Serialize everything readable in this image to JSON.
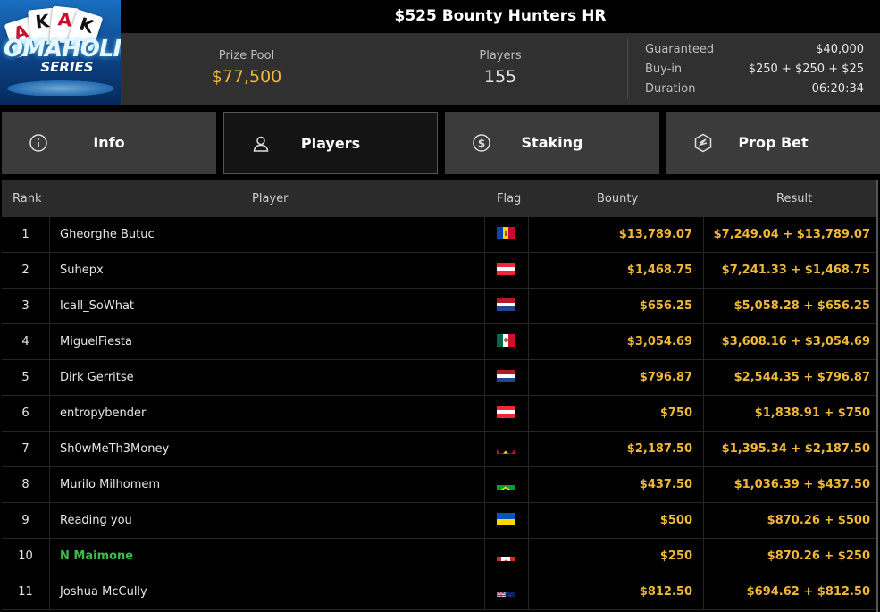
{
  "title": "$525 Bounty Hunters HR",
  "logo": {
    "cards": [
      "A",
      "K",
      "A",
      "K"
    ],
    "word1": "OMAHOLIC",
    "word2": "SERIES"
  },
  "stats": {
    "prize_pool": {
      "label": "Prize Pool",
      "value": "$77,500",
      "color": "#f0b83a"
    },
    "players": {
      "label": "Players",
      "value": "155"
    }
  },
  "details": [
    {
      "label": "Guaranteed",
      "value": "$40,000"
    },
    {
      "label": "Buy-in",
      "value": "$250 + $250 + $25"
    },
    {
      "label": "Duration",
      "value": "06:20:34"
    }
  ],
  "tabs": [
    {
      "label": "Info",
      "icon": "info-icon"
    },
    {
      "label": "Players",
      "icon": "user-icon",
      "active": true
    },
    {
      "label": "Staking",
      "icon": "staking-coin-icon"
    },
    {
      "label": "Prop Bet",
      "icon": "prop-bet-icon"
    }
  ],
  "table": {
    "headers": {
      "rank": "Rank",
      "player": "Player",
      "flag": "Flag",
      "bounty": "Bounty",
      "result": "Result"
    },
    "rows": [
      {
        "rank": "1",
        "player": "Gheorghe Butuc",
        "flag": "moldova",
        "bounty": "$13,789.07",
        "result": "$7,249.04 + $13,789.07"
      },
      {
        "rank": "2",
        "player": "Suhepx",
        "flag": "austria",
        "bounty": "$1,468.75",
        "result": "$7,241.33 + $1,468.75"
      },
      {
        "rank": "3",
        "player": "Icall_SoWhat",
        "flag": "netherlands",
        "bounty": "$656.25",
        "result": "$5,058.28 + $656.25"
      },
      {
        "rank": "4",
        "player": "MiguelFiesta",
        "flag": "mexico",
        "bounty": "$3,054.69",
        "result": "$3,608.16 + $3,054.69"
      },
      {
        "rank": "5",
        "player": "Dirk Gerritse",
        "flag": "netherlands",
        "bounty": "$796.87",
        "result": "$2,544.35 + $796.87"
      },
      {
        "rank": "6",
        "player": "entropybender",
        "flag": "austria",
        "bounty": "$750",
        "result": "$1,838.91 + $750"
      },
      {
        "rank": "7",
        "player": "Sh0wMeTh3Money",
        "flag": "antigua",
        "bounty": "$2,187.50",
        "result": "$1,395.34 + $2,187.50"
      },
      {
        "rank": "8",
        "player": "Murilo Milhomem",
        "flag": "brazil",
        "bounty": "$437.50",
        "result": "$1,036.39 + $437.50"
      },
      {
        "rank": "9",
        "player": "Reading you",
        "flag": "ukraine",
        "bounty": "$500",
        "result": "$870.26 + $500"
      },
      {
        "rank": "10",
        "player": "N Maimone",
        "flag": "canada",
        "bounty": "$250",
        "result": "$870.26 + $250",
        "highlight": true
      },
      {
        "rank": "11",
        "player": "Joshua McCully",
        "flag": "new-zealand",
        "bounty": "$812.50",
        "result": "$694.62 + $812.50"
      }
    ]
  }
}
